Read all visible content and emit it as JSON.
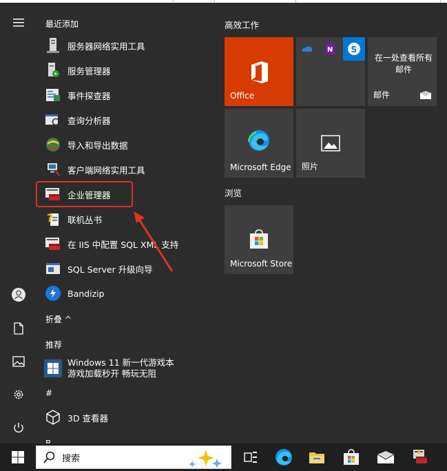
{
  "recent": {
    "header": "最近添加",
    "items": [
      {
        "label": "服务器网络实用工具"
      },
      {
        "label": "服务管理器"
      },
      {
        "label": "事件探查器"
      },
      {
        "label": "查询分析器"
      },
      {
        "label": "导入和导出数据"
      },
      {
        "label": "客户端网络实用工具"
      },
      {
        "label": "企业管理器"
      },
      {
        "label": "联机丛书"
      },
      {
        "label": "在 IIS 中配置 SQL XML 支持"
      },
      {
        "label": "SQL Server 升级向导"
      },
      {
        "label": "Bandizip"
      }
    ],
    "collapse": "折叠 ^"
  },
  "recommended": {
    "header": "推荐",
    "item_line1": "Windows 11 新一代游戏本",
    "item_line2": "游戏加载秒开 畅玩无阻"
  },
  "hash_section": {
    "header": "#",
    "item": "3D 查看器",
    "next_header": "B"
  },
  "tiles": {
    "group1": "高效工作",
    "office": "Office",
    "mail_text": "在一处查看所有邮件",
    "mail": "邮件",
    "edge": "Microsoft Edge",
    "photos": "照片",
    "group2": "浏览",
    "store": "Microsoft Store"
  },
  "taskbar": {
    "search_placeholder": "搜索"
  },
  "colors": {
    "start_bg": "#2c2c2c",
    "tile_bg": "#3e3e3e",
    "office_tile": "#d83b01",
    "highlight": "#e0302c",
    "taskbar_bg": "#1f1f1f"
  }
}
